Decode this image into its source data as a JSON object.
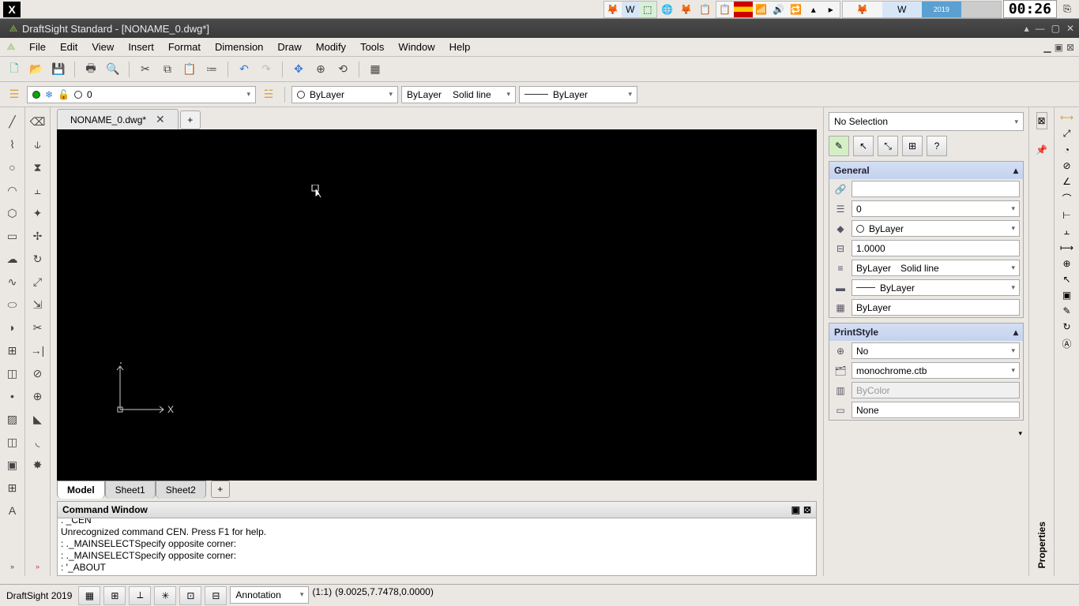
{
  "os": {
    "clock": "00:26"
  },
  "title": "DraftSight Standard - [NONAME_0.dwg*]",
  "menu": [
    "File",
    "Edit",
    "View",
    "Insert",
    "Format",
    "Dimension",
    "Draw",
    "Modify",
    "Tools",
    "Window",
    "Help"
  ],
  "layer_toolbar": {
    "layer_dd": "0",
    "color_dd": "ByLayer",
    "line_dd1": "ByLayer",
    "line_dd2": "Solid line",
    "lw_dd": "ByLayer"
  },
  "doc_tab": "NONAME_0.dwg*",
  "sheet_tabs": [
    "Model",
    "Sheet1",
    "Sheet2"
  ],
  "command_window": {
    "title": "Command Window",
    "lines": [
      ". _CEN",
      "Unrecognized command CEN. Press F1 for help.",
      ": ._MAINSELECTSpecify opposite corner:",
      ": ._MAINSELECTSpecify opposite corner:",
      ": '_ABOUT"
    ]
  },
  "properties": {
    "top_select": "No Selection",
    "general_title": "General",
    "layer": "0",
    "color": "ByLayer",
    "scale": "1.0000",
    "linetype1": "ByLayer",
    "linetype2": "Solid line",
    "lineweight": "ByLayer",
    "transparency": "ByLayer",
    "printstyle_title": "PrintStyle",
    "ps_no": "No",
    "ps_file": "monochrome.ctb",
    "ps_bycolor": "ByColor",
    "ps_none": "None",
    "sidebar_label": "Properties"
  },
  "status": {
    "app": "DraftSight 2019",
    "anno": "Annotation",
    "scale": "(1:1)",
    "coords": "(9.0025,7.7478,0.0000)"
  }
}
